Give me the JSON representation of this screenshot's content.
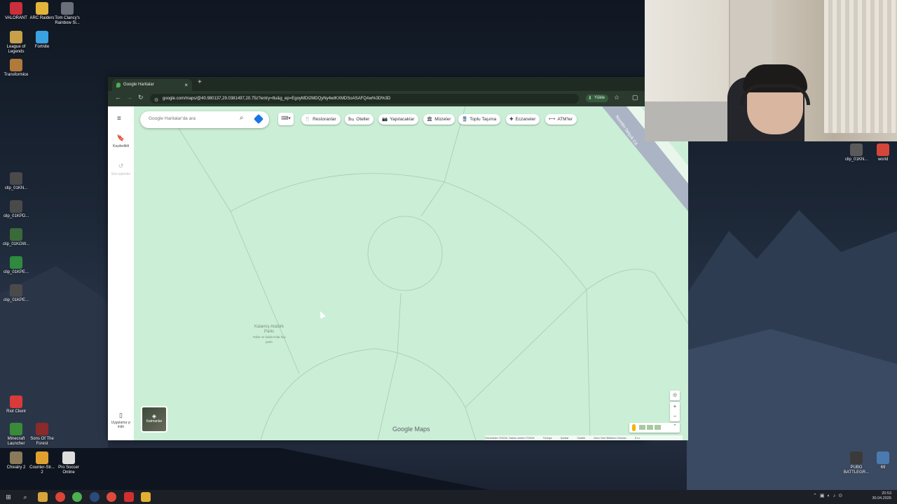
{
  "desktop": {
    "icons_left": [
      {
        "label": "VALORANT",
        "color": "#c9303a"
      },
      {
        "label": "ARC Raiders",
        "color": "#e2b53a"
      },
      {
        "label": "Tom Clancy's Rainbow Si...",
        "color": "#6a6f7a"
      },
      {
        "label": "League of Legends",
        "color": "#c8a04a"
      },
      {
        "label": "Fortnite",
        "color": "#3aa2e0"
      },
      {
        "label": "Transformice",
        "color": "#b07a3a"
      },
      {
        "label": "clip_01KN...",
        "color": "#4a4a4a"
      },
      {
        "label": "clip_01KPD...",
        "color": "#4a4a4a"
      },
      {
        "label": "clip_01KGW...",
        "color": "#3a6a3a"
      },
      {
        "label": "clip_01KPE...",
        "color": "#2e8a3e"
      },
      {
        "label": "clip_01KPE...",
        "color": "#4a4a4a"
      },
      {
        "label": "Riot Client",
        "color": "#d93a3a"
      },
      {
        "label": "Minecraft Launcher",
        "color": "#3a8a3a"
      },
      {
        "label": "Sons Of The Forest",
        "color": "#8a2a2a"
      },
      {
        "label": "Chivalry 2",
        "color": "#8a7a5a"
      },
      {
        "label": "Counter-Str... 2",
        "color": "#e0a030"
      },
      {
        "label": "Pro Soccer Online",
        "color": "#dddddd"
      }
    ],
    "icons_right": [
      {
        "label": "clip_01KN...",
        "color": "#5a5a5a"
      },
      {
        "label": "world",
        "color": "#d4463a"
      },
      {
        "label": "PUBG BATTLEGR...",
        "color": "#3a3a3a"
      },
      {
        "label": "69",
        "color": "#4a7ab0"
      }
    ]
  },
  "browser": {
    "tab_title": "Google Haritalar",
    "tab_close": "×",
    "new_tab": "+",
    "url": "google.com/maps/@40.980137,29.0381497,20.75z?entry=ttu&g_ep=EgoyMDI2MDQyNy4wIKXMDSoASAFQAw%3D%3D",
    "update_label": "Yükle",
    "nav_back": "←",
    "nav_forward": "→",
    "nav_reload": "↻"
  },
  "maps": {
    "search_placeholder": "Google Haritalar'da ara",
    "menu_icon": "≡",
    "saved_label": "Kaydedildi",
    "recent_label": "Son işlemler",
    "get_app_label": "Uygulama yı indir",
    "chips": [
      {
        "icon": "🍴",
        "label": "Restoranlar"
      },
      {
        "icon": "🛏",
        "label": "Oteller"
      },
      {
        "icon": "📷",
        "label": "Yapılacaklar"
      },
      {
        "icon": "🏛",
        "label": "Müzeler"
      },
      {
        "icon": "🚆",
        "label": "Toplu Taşıma"
      },
      {
        "icon": "✚",
        "label": "Eczaneler"
      },
      {
        "icon": "⟷",
        "label": "ATM'ler"
      }
    ],
    "park_label": "Kalamış Atatürk Parkı",
    "park_sublabel": "Yollar ve kaldırımlar kişi parkı",
    "road_label": "Nurettin Selçuk Cd.",
    "layers_label": "Katmanlar",
    "logo": "Google Maps",
    "attribution": [
      "Görüntüler ©2026, Harita verileri ©2026",
      "Türkiye",
      "Şartlar",
      "Gizlilik",
      "Ürün Geri Bildirimi Gönder",
      "5 m"
    ],
    "zoom_in": "+",
    "zoom_out": "−",
    "colors": {
      "park": "#cbeed6",
      "road": "#aab4c4",
      "accent": "#1a73e8"
    }
  },
  "taskbar": {
    "time": "20:53",
    "date": "30.04.2026",
    "apps": [
      "windows-icon",
      "search-icon",
      "file-explorer-icon",
      "chrome-icon",
      "chrome-icon",
      "steam-icon",
      "browser-icon",
      "riot-icon",
      "app-icon"
    ]
  }
}
